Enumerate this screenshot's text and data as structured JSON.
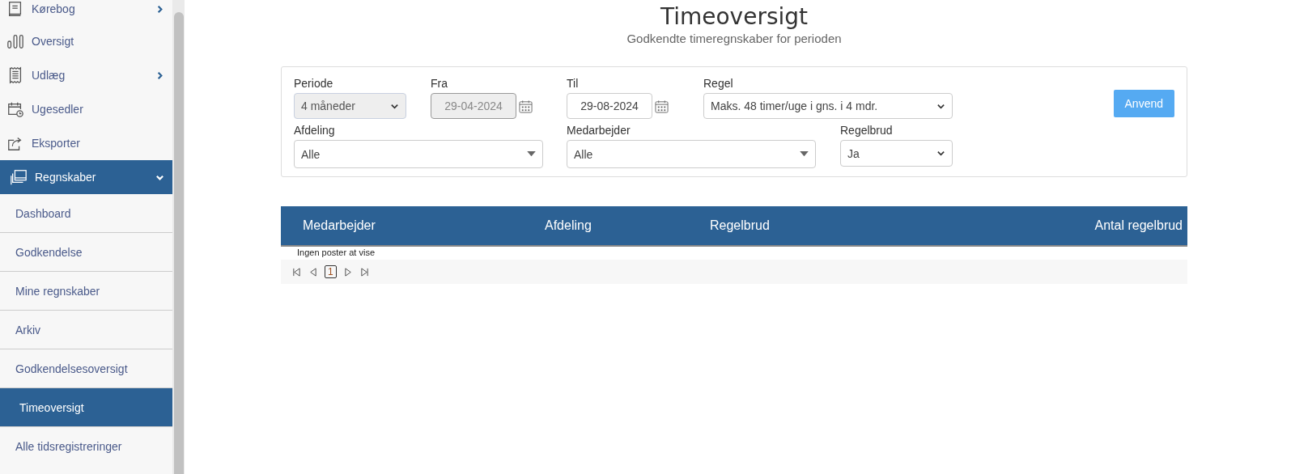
{
  "sidebar": {
    "items": [
      {
        "label": "Kørebog",
        "expanded": false,
        "selected": false
      },
      {
        "label": "Oversigt",
        "selected": false
      },
      {
        "label": "Udlæg",
        "expanded": false,
        "selected": false
      },
      {
        "label": "Ugesedler",
        "selected": false
      },
      {
        "label": "Eksporter",
        "selected": false
      },
      {
        "label": "Regnskaber",
        "expanded": true,
        "selected": true,
        "children": [
          {
            "label": "Dashboard",
            "selected": false
          },
          {
            "label": "Godkendelse",
            "selected": false
          },
          {
            "label": "Mine regnskaber",
            "selected": false
          },
          {
            "label": "Arkiv",
            "selected": false
          },
          {
            "label": "Godkendelsesoversigt",
            "selected": false
          },
          {
            "label": "Timeoversigt",
            "selected": true
          },
          {
            "label": "Alle tidsregistreringer",
            "selected": false
          }
        ]
      }
    ]
  },
  "page": {
    "title": "Timeoversigt",
    "subtitle": "Godkendte timeregnskaber for perioden"
  },
  "filters": [
    {
      "label": "Periode",
      "kind": "select",
      "value": "4 måneder",
      "disabled": true
    },
    {
      "label": "Fra",
      "kind": "date",
      "value": "29-04-2024",
      "disabled": true
    },
    {
      "label": "Til",
      "kind": "date",
      "value": "29-08-2024",
      "disabled": false
    },
    {
      "label": "Regel",
      "kind": "select",
      "value": "Maks. 48 timer/uge i gns. i 4 mdr.",
      "disabled": false
    },
    {
      "label": "Afdeling",
      "kind": "combo",
      "value": "Alle",
      "disabled": false
    },
    {
      "label": "Medarbejder",
      "kind": "combo",
      "value": "Alle",
      "disabled": false
    },
    {
      "label": "Regelbrud",
      "kind": "select",
      "value": "Ja",
      "disabled": false
    }
  ],
  "apply_button": "Anvend",
  "table": {
    "columns": [
      "Medarbejder",
      "Afdeling",
      "Regelbrud",
      "Antal regelbrud"
    ],
    "empty_message": "Ingen poster at vise"
  },
  "pagination": {
    "pages": [
      {
        "label": "1",
        "selected": true
      }
    ]
  }
}
